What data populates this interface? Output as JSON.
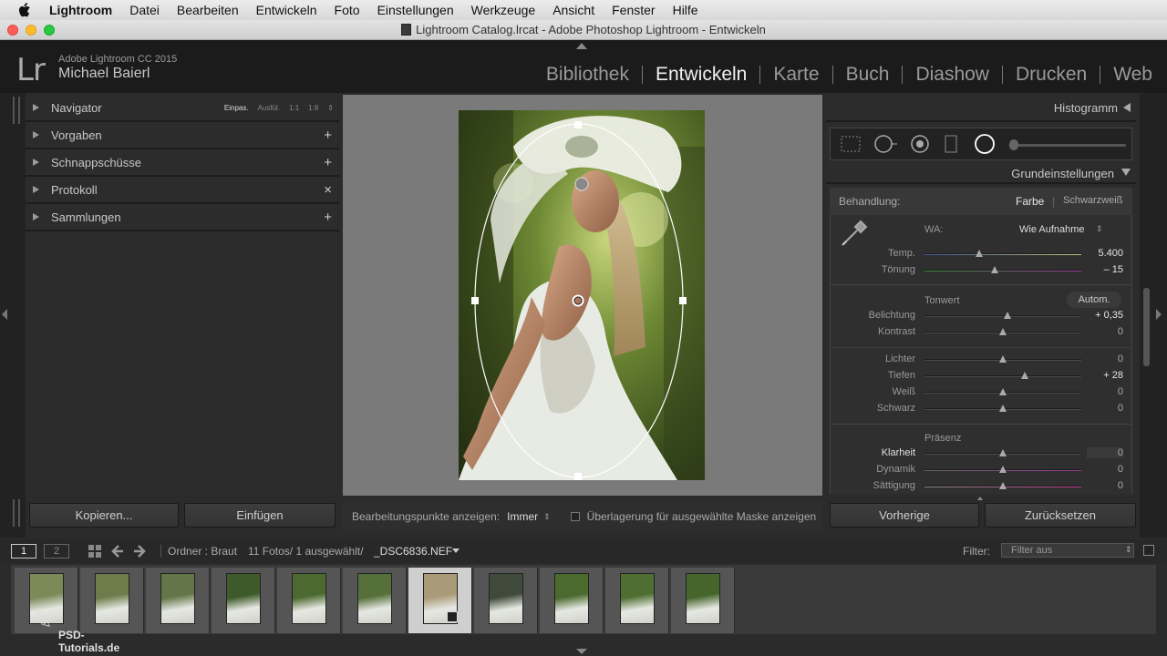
{
  "menubar": {
    "app": "Lightroom",
    "items": [
      "Datei",
      "Bearbeiten",
      "Entwickeln",
      "Foto",
      "Einstellungen",
      "Werkzeuge",
      "Ansicht",
      "Fenster",
      "Hilfe"
    ]
  },
  "window": {
    "title": "Lightroom Catalog.lrcat - Adobe Photoshop Lightroom - Entwickeln"
  },
  "identity": {
    "logo": "Lr",
    "product": "Adobe Lightroom CC 2015",
    "user": "Michael Baierl"
  },
  "modules": [
    "Bibliothek",
    "Entwickeln",
    "Karte",
    "Buch",
    "Diashow",
    "Drucken",
    "Web"
  ],
  "active_module": "Entwickeln",
  "left": {
    "navigator": {
      "label": "Navigator",
      "options": [
        "Einpas.",
        "Ausfül.",
        "1:1",
        "1:8"
      ]
    },
    "panels": [
      {
        "label": "Vorgaben",
        "action": "+"
      },
      {
        "label": "Schnappschüsse",
        "action": "+"
      },
      {
        "label": "Protokoll",
        "action": "×"
      },
      {
        "label": "Sammlungen",
        "action": "+"
      }
    ],
    "copy_button": "Kopieren...",
    "paste_button": "Einfügen"
  },
  "toolbar": {
    "show_points_label": "Bearbeitungspunkte anzeigen:",
    "show_points_value": "Immer",
    "overlay_label": "Überlagerung für ausgewählte Maske anzeigen"
  },
  "right": {
    "histogram_label": "Histogramm",
    "basic_label": "Grundeinstellungen",
    "treatment_label": "Behandlung:",
    "treatment_color": "Farbe",
    "treatment_bw": "Schwarzweiß",
    "wb_label": "WA:",
    "wb_value": "Wie Aufnahme",
    "tone_label": "Tonwert",
    "auto_label": "Autom.",
    "presence_label": "Präsenz",
    "sliders": [
      {
        "label": "Temp.",
        "value": "5.400",
        "pos": 0.35
      },
      {
        "label": "Tönung",
        "value": "– 15",
        "pos": 0.45
      },
      {
        "label": "Belichtung",
        "value": "+ 0,35",
        "pos": 0.53
      },
      {
        "label": "Kontrast",
        "value": "0",
        "pos": 0.5
      },
      {
        "label": "Lichter",
        "value": "0",
        "pos": 0.5
      },
      {
        "label": "Tiefen",
        "value": "+ 28",
        "pos": 0.64
      },
      {
        "label": "Weiß",
        "value": "0",
        "pos": 0.5
      },
      {
        "label": "Schwarz",
        "value": "0",
        "pos": 0.5
      },
      {
        "label": "Klarheit",
        "value": "0",
        "pos": 0.5
      },
      {
        "label": "Dynamik",
        "value": "0",
        "pos": 0.5
      },
      {
        "label": "Sättigung",
        "value": "0",
        "pos": 0.5
      }
    ],
    "prev_button": "Vorherige",
    "reset_button": "Zurücksetzen"
  },
  "filmbar": {
    "view1": "1",
    "view2": "2",
    "source": "Ordner : Braut",
    "count": "11 Fotos/ 1 ausgewählt/",
    "filename": "_DSC6836.NEF",
    "filter_label": "Filter:",
    "filter_value": "Filter aus"
  },
  "watermark": "PSD-Tutorials.de"
}
